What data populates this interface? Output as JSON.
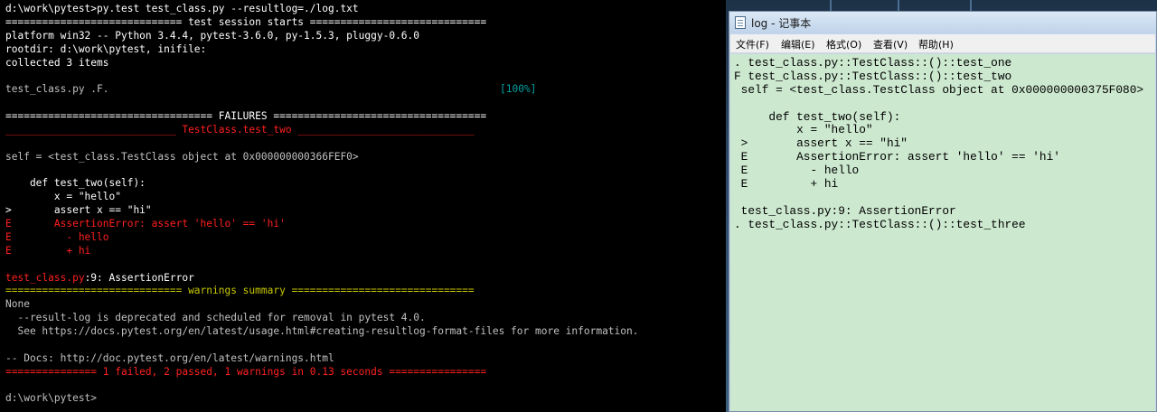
{
  "console": {
    "lines": [
      {
        "text": "d:\\work\\pytest>py.test test_class.py --resultlog=./log.txt",
        "style": "white"
      },
      {
        "text": "============================= test session starts =============================",
        "style": "white"
      },
      {
        "text": "platform win32 -- Python 3.4.4, pytest-3.6.0, py-1.5.3, pluggy-0.6.0",
        "style": "white"
      },
      {
        "text": "rootdir: d:\\work\\pytest, inifile:",
        "style": "white"
      },
      {
        "text": "collected 3 items",
        "style": "white"
      },
      {
        "text": "",
        "style": "dim"
      },
      {
        "text": "test_class.py .F.",
        "style": "dim",
        "percent": "[100%]"
      },
      {
        "text": "",
        "style": "dim"
      },
      {
        "text": "================================== FAILURES ===================================",
        "style": "white"
      },
      {
        "text": "____________________________ TestClass.test_two _____________________________",
        "style": "red"
      },
      {
        "text": "",
        "style": "dim"
      },
      {
        "text": "self = <test_class.TestClass object at 0x000000000366FEF0>",
        "style": "dim"
      },
      {
        "text": "",
        "style": "dim"
      },
      {
        "text": "    def test_two(self):",
        "style": "white"
      },
      {
        "text": "        x = \"hello\"",
        "style": "white"
      },
      {
        "text": ">       assert x == \"hi\"",
        "style": "white"
      },
      {
        "text": "E       AssertionError: assert 'hello' == 'hi'",
        "style": "red"
      },
      {
        "text": "E         - hello",
        "style": "red"
      },
      {
        "text": "E         + hi",
        "style": "red"
      },
      {
        "text": "",
        "style": "dim"
      },
      {
        "text": "test_class.py:9: AssertionError",
        "style": "mixed"
      },
      {
        "text": "============================= warnings summary ==============================",
        "style": "yellow"
      },
      {
        "text": "None",
        "style": "dim"
      },
      {
        "text": "  --result-log is deprecated and scheduled for removal in pytest 4.0.",
        "style": "dim"
      },
      {
        "text": "  See https://docs.pytest.org/en/latest/usage.html#creating-resultlog-format-files for more information.",
        "style": "dim"
      },
      {
        "text": "",
        "style": "dim"
      },
      {
        "text": "-- Docs: http://doc.pytest.org/en/latest/warnings.html",
        "style": "dim"
      },
      {
        "text": "=============== 1 failed, 2 passed, 1 warnings in 0.13 seconds ================",
        "style": "red"
      },
      {
        "text": "",
        "style": "dim"
      },
      {
        "text": "d:\\work\\pytest>",
        "style": "dim"
      }
    ]
  },
  "notepad": {
    "title": "log - 记事本",
    "menu": [
      "文件(F)",
      "编辑(E)",
      "格式(O)",
      "查看(V)",
      "帮助(H)"
    ],
    "lines": [
      ". test_class.py::TestClass::()::test_one",
      "F test_class.py::TestClass::()::test_two",
      " self = <test_class.TestClass object at 0x000000000375F080>",
      "",
      "     def test_two(self):",
      "         x = \"hello\"",
      " >       assert x == \"hi\"",
      " E       AssertionError: assert 'hello' == 'hi'",
      " E         - hello",
      " E         + hi",
      "",
      " test_class.py:9: AssertionError",
      ". test_class.py::TestClass::()::test_three"
    ]
  },
  "colors": {
    "console_bg": "#000000",
    "console_text": "#c0c0c0",
    "error_red": "#ff2020",
    "warning_yellow": "#c8c800",
    "progress_cyan": "#00a0a0",
    "notepad_bg": "#cce8cf"
  }
}
